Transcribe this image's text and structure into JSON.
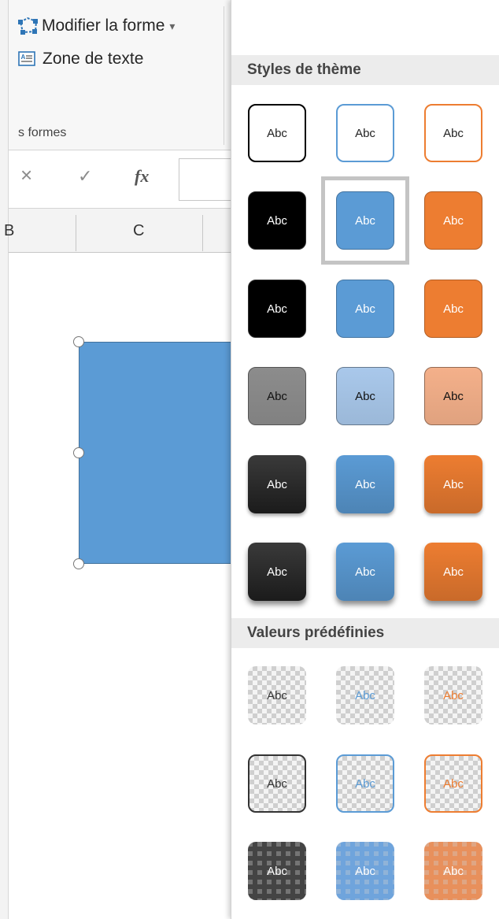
{
  "ribbon": {
    "edit_shape_label": "Modifier la forme",
    "text_box_label": "Zone de texte",
    "group_label": "s formes",
    "dropdown_arrow": "▾"
  },
  "formula_bar": {
    "cancel_symbol": "×",
    "enter_symbol": "✓",
    "fx_label": "fx"
  },
  "columns": {
    "b_label": "B",
    "c_label": "C"
  },
  "panel": {
    "theme_styles_header": "Styles de thème",
    "presets_header": "Valeurs prédéfinies",
    "style_text": "Abc",
    "theme_rows": [
      {
        "kind": "outline",
        "colors": [
          "#000000",
          "#5b9bd5",
          "#ed7d31"
        ]
      },
      {
        "kind": "filled",
        "colors": [
          "#000000",
          "#5b9bd5",
          "#ed7d31"
        ]
      },
      {
        "kind": "filled",
        "colors": [
          "#000000",
          "#5b9bd5",
          "#ed7d31"
        ]
      },
      {
        "kind": "subtle",
        "colors": [
          "#8c8c8c",
          "#a9c8eb",
          "#f4b08a"
        ]
      },
      {
        "kind": "intense",
        "colors": [
          "#000000",
          "#5b9bd5",
          "#ed7d31"
        ]
      },
      {
        "kind": "intense",
        "colors": [
          "#000000",
          "#5b9bd5",
          "#ed7d31"
        ]
      }
    ],
    "preset_rows": [
      {
        "kind": "transparent",
        "colors": [
          "#333333",
          "#5b9bd5",
          "#ed7d31"
        ]
      },
      {
        "kind": "transparent-outline",
        "colors": [
          "#333333",
          "#5b9bd5",
          "#ed7d31"
        ]
      },
      {
        "kind": "semi-filled",
        "colors": [
          "#444444",
          "#6fa4dc",
          "#e8905c"
        ]
      }
    ],
    "selected_style": "row 2, column 2"
  }
}
